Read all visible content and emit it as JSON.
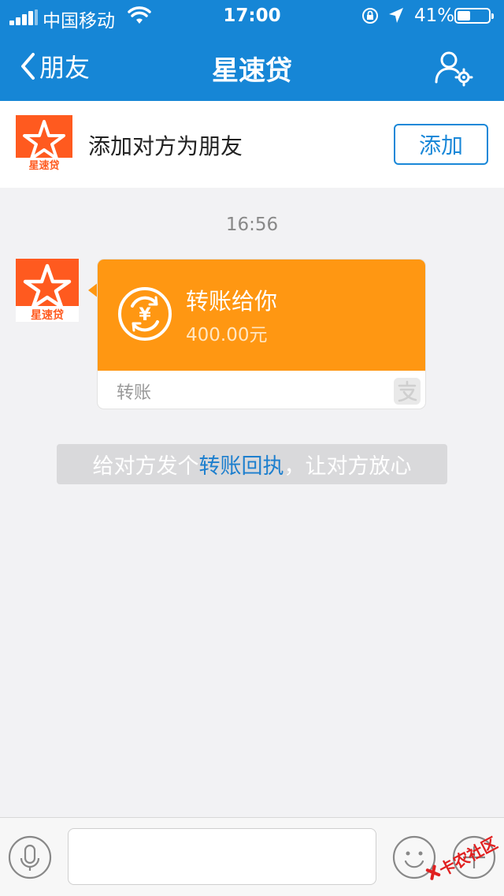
{
  "status_bar": {
    "carrier": "中国移动",
    "time": "17:00",
    "battery": "41%",
    "battery_level": 0.41
  },
  "nav": {
    "back_label": "朋友",
    "title": "星速贷"
  },
  "add_bar": {
    "logo_text": "星速贷",
    "text": "添加对方为朋友",
    "button_label": "添加"
  },
  "chat": {
    "timestamp": "16:56",
    "transfer_card": {
      "title": "转账给你",
      "amount": "400.00元",
      "footer_label": "转账",
      "icon_symbol": "¥"
    },
    "receipt": {
      "prefix": "给对方发个",
      "link": "转账回执",
      "suffix": "，让对方放心"
    }
  },
  "watermark": "卡农社区",
  "colors": {
    "header_bg": "#1686d6",
    "card_orange": "#ff9712",
    "link_blue": "#1d7fce"
  }
}
